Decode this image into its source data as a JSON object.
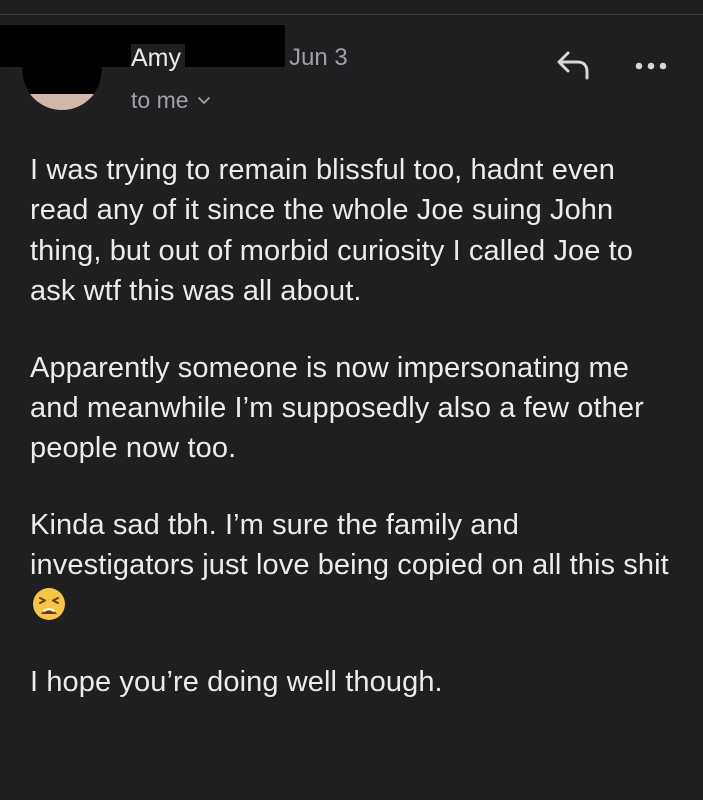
{
  "message": {
    "sender_name": "Amy",
    "date": "Jun 3",
    "recipient_label": "to me",
    "paragraphs": [
      "I was trying to remain blissful too, hadnt even read any of it since the whole Joe suing John thing, but out of morbid curiosity I called Joe to ask wtf this was all about.",
      "Apparently someone is now impersonating me and meanwhile I’m supposedly also a few other people now too.",
      "Kinda sad tbh. I’m sure the family and investigators just love being copied on all this shit",
      "I hope you’re doing well though."
    ]
  },
  "icons": {
    "reply": "reply-arrow-icon",
    "more": "more-horizontal-icon",
    "chevron": "chevron-down-icon",
    "emoji": "tired-face-emoji"
  },
  "colors": {
    "background": "#1f1f21",
    "text": "#ebebeb",
    "secondary_text": "#a0a0a5",
    "emoji": "#f6c543"
  }
}
